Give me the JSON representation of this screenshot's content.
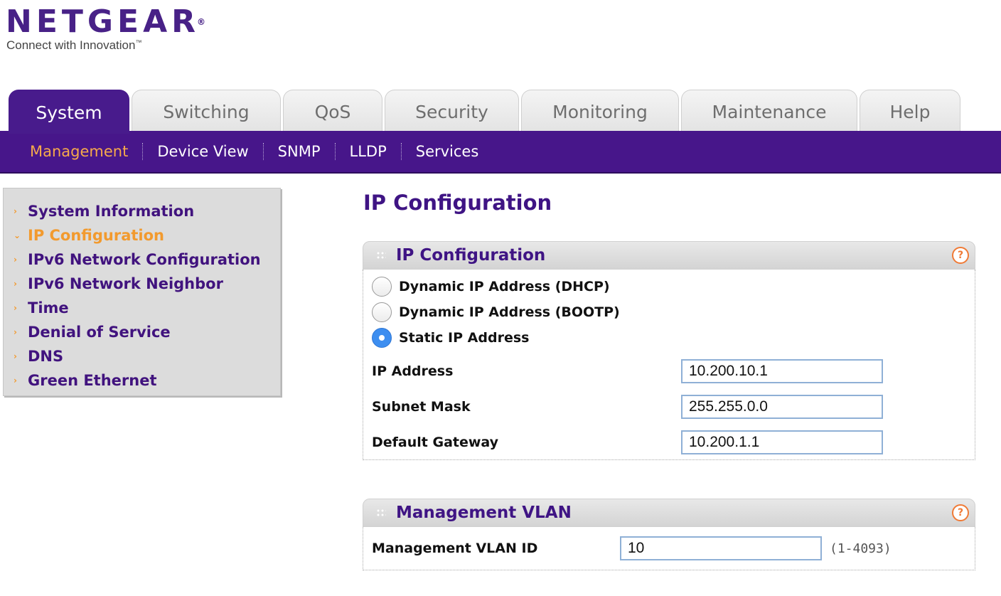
{
  "brand": {
    "name": "NETGEAR",
    "reg_mark": "®",
    "tagline": "Connect with Innovation",
    "tm_mark": "™",
    "color": "#482187"
  },
  "tabs": [
    {
      "label": "System",
      "active": true
    },
    {
      "label": "Switching",
      "active": false
    },
    {
      "label": "QoS",
      "active": false
    },
    {
      "label": "Security",
      "active": false
    },
    {
      "label": "Monitoring",
      "active": false
    },
    {
      "label": "Maintenance",
      "active": false
    },
    {
      "label": "Help",
      "active": false
    }
  ],
  "subnav": [
    {
      "label": "Management",
      "active": true
    },
    {
      "label": "Device View",
      "active": false
    },
    {
      "label": "SNMP",
      "active": false
    },
    {
      "label": "LLDP",
      "active": false
    },
    {
      "label": "Services",
      "active": false
    }
  ],
  "sidebar": {
    "items": [
      {
        "label": "System Information",
        "active": false
      },
      {
        "label": "IP Configuration",
        "active": true
      },
      {
        "label": "IPv6 Network Configuration",
        "active": false
      },
      {
        "label": "IPv6 Network Neighbor",
        "active": false
      },
      {
        "label": "Time",
        "active": false
      },
      {
        "label": "Denial of Service",
        "active": false
      },
      {
        "label": "DNS",
        "active": false
      },
      {
        "label": "Green Ethernet",
        "active": false
      }
    ]
  },
  "page": {
    "title": "IP Configuration"
  },
  "ip_panel": {
    "title": "IP Configuration",
    "help_symbol": "?",
    "options": [
      {
        "label": "Dynamic IP Address (DHCP)",
        "checked": false
      },
      {
        "label": "Dynamic IP Address (BOOTP)",
        "checked": false
      },
      {
        "label": "Static IP Address",
        "checked": true
      }
    ],
    "fields": [
      {
        "label": "IP Address",
        "value": "10.200.10.1"
      },
      {
        "label": "Subnet Mask",
        "value": "255.255.0.0"
      },
      {
        "label": "Default Gateway",
        "value": "10.200.1.1"
      }
    ]
  },
  "vlan_panel": {
    "title": "Management VLAN",
    "help_symbol": "?",
    "field_label": "Management VLAN ID",
    "value": "10",
    "range": "(1-4093)"
  },
  "colors": {
    "accent_purple": "#47168a",
    "active_orange": "#f29a2e",
    "radio_selected": "#3d8ef0"
  }
}
